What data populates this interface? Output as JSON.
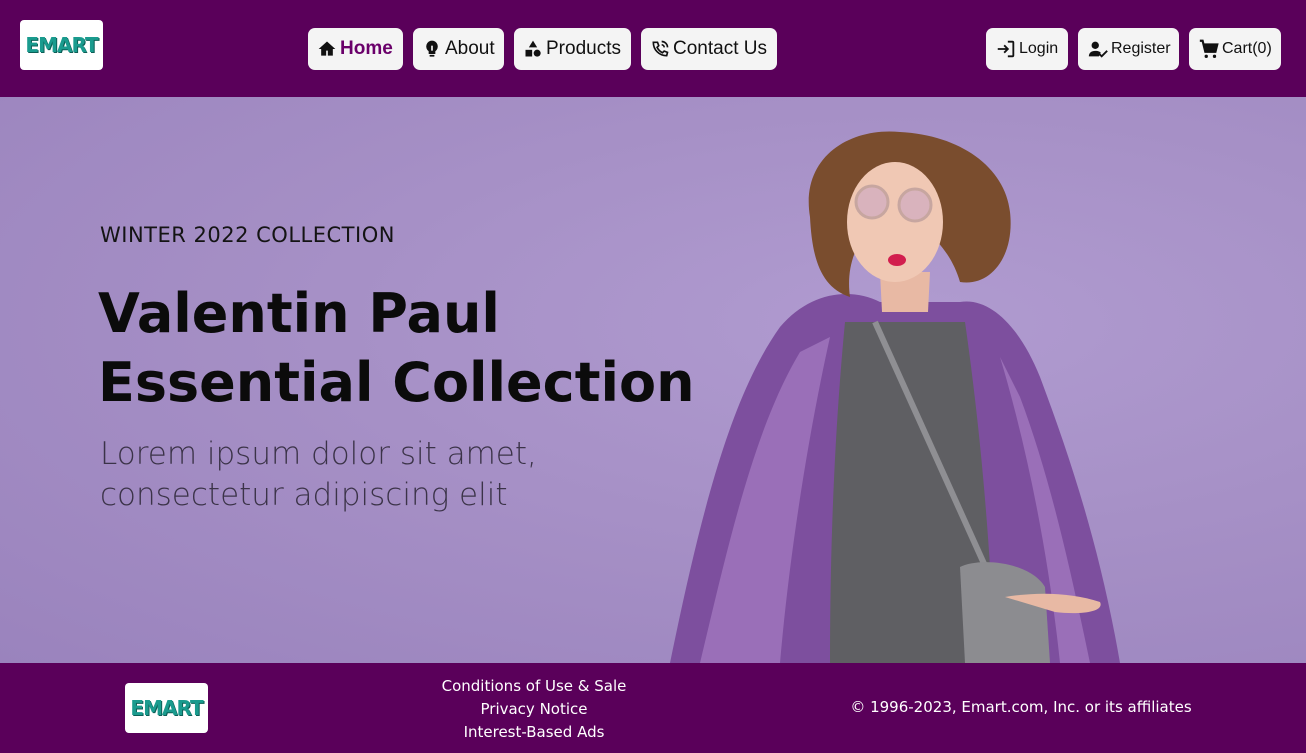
{
  "brand": {
    "logo_text": "EMART",
    "accent": "#1a9b8e",
    "theme": "#5a005a"
  },
  "nav": {
    "home": {
      "label": "Home",
      "icon": "home-icon",
      "active": true
    },
    "about": {
      "label": "About",
      "icon": "lightbulb-icon"
    },
    "products": {
      "label": "Products",
      "icon": "shapes-icon"
    },
    "contact": {
      "label": "Contact Us",
      "icon": "phone-signal-icon"
    }
  },
  "account": {
    "login": {
      "label": "Login",
      "icon": "login-icon"
    },
    "register": {
      "label": "Register",
      "icon": "user-check-icon"
    },
    "cart": {
      "label": "Cart(0)",
      "icon": "cart-icon"
    }
  },
  "hero": {
    "eyebrow": "WINTER 2022 COLLECTION",
    "title_line1": "Valentin Paul",
    "title_line2": "Essential Collection",
    "subtitle_line1": "Lorem ipsum dolor sit amet,",
    "subtitle_line2": "consectetur adipiscing elit",
    "background": "#a690c6"
  },
  "footer": {
    "links": [
      "Conditions of Use & Sale",
      "Privacy Notice",
      "Interest-Based Ads"
    ],
    "copyright": "© 1996-2023, Emart.com, Inc. or its affiliates"
  }
}
